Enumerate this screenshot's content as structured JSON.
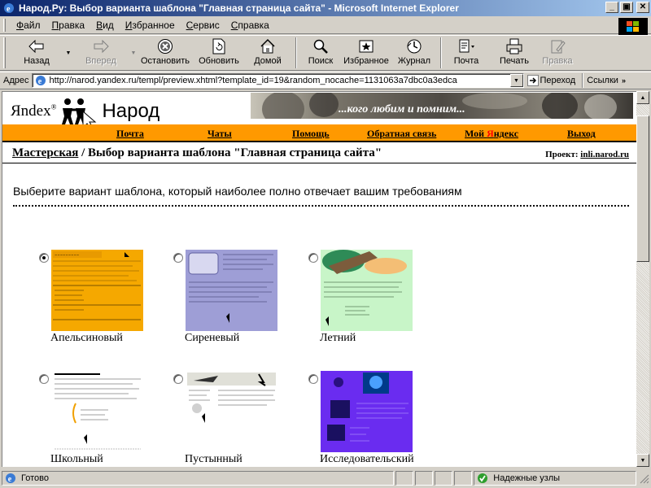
{
  "window": {
    "title": "Народ.Ру: Выбор варианта шаблона \"Главная страница сайта\" - Microsoft Internet Explorer"
  },
  "menu": [
    {
      "u": "Ф",
      "rest": "айл"
    },
    {
      "u": "П",
      "rest": "равка"
    },
    {
      "u": "В",
      "rest": "ид"
    },
    {
      "u": "И",
      "rest": "збранное"
    },
    {
      "u": "С",
      "rest": "ервис"
    },
    {
      "u": "С",
      "rest": "правка"
    }
  ],
  "toolbar": {
    "back": "Назад",
    "forward": "Вперед",
    "stop": "Остановить",
    "refresh": "Обновить",
    "home": "Домой",
    "search": "Поиск",
    "favorites": "Избранное",
    "history": "Журнал",
    "mail": "Почта",
    "print": "Печать",
    "edit": "Правка"
  },
  "address": {
    "label": "Адрес",
    "url": "http://narod.yandex.ru/templ/preview.xhtml?template_id=19&random_nocache=1131063a7dbc0a3edca",
    "go": "Переход",
    "links": "Ссылки"
  },
  "site": {
    "logo_yandex": "Яndex",
    "logo_reg": "®",
    "logo_narod": "Народ",
    "banner_caption": "...кого любим и помним...",
    "nav": {
      "mail": "Почта",
      "chats": "Чаты",
      "help": "Помощь",
      "feedback": "Обратная связь",
      "my_yandex_prefix": "Мой ",
      "my_yandex_ya": "Я",
      "my_yandex_suffix": "ндекс",
      "exit": "Выход"
    },
    "breadcrumb_link": "Мастерская",
    "breadcrumb_rest": " / Выбор варианта шаблона \"Главная страница сайта\"",
    "project_label": "Проект: ",
    "project_link": "inli.narod.ru",
    "intro": "Выберите вариант шаблона, который наиболее полно отвечает вашим требованиям"
  },
  "templates": [
    {
      "name": "Апельсиновый",
      "checked": true,
      "color": "#f5a800"
    },
    {
      "name": "Сиреневый",
      "checked": false,
      "color": "#9e9ed6"
    },
    {
      "name": "Летний",
      "checked": false,
      "color": "#c8f5c8"
    },
    {
      "name": "Школьный",
      "checked": false,
      "color": "#ffffff"
    },
    {
      "name": "Пустынный",
      "checked": false,
      "color": "#ffffff"
    },
    {
      "name": "Исследовательский",
      "checked": false,
      "color": "#6a2cf0"
    }
  ],
  "status": {
    "text": "Готово",
    "zone": "Надежные узлы"
  },
  "colors": {
    "titlebar": "#0a246a",
    "orange": "#ff9900",
    "chrome": "#d4d0c8"
  }
}
